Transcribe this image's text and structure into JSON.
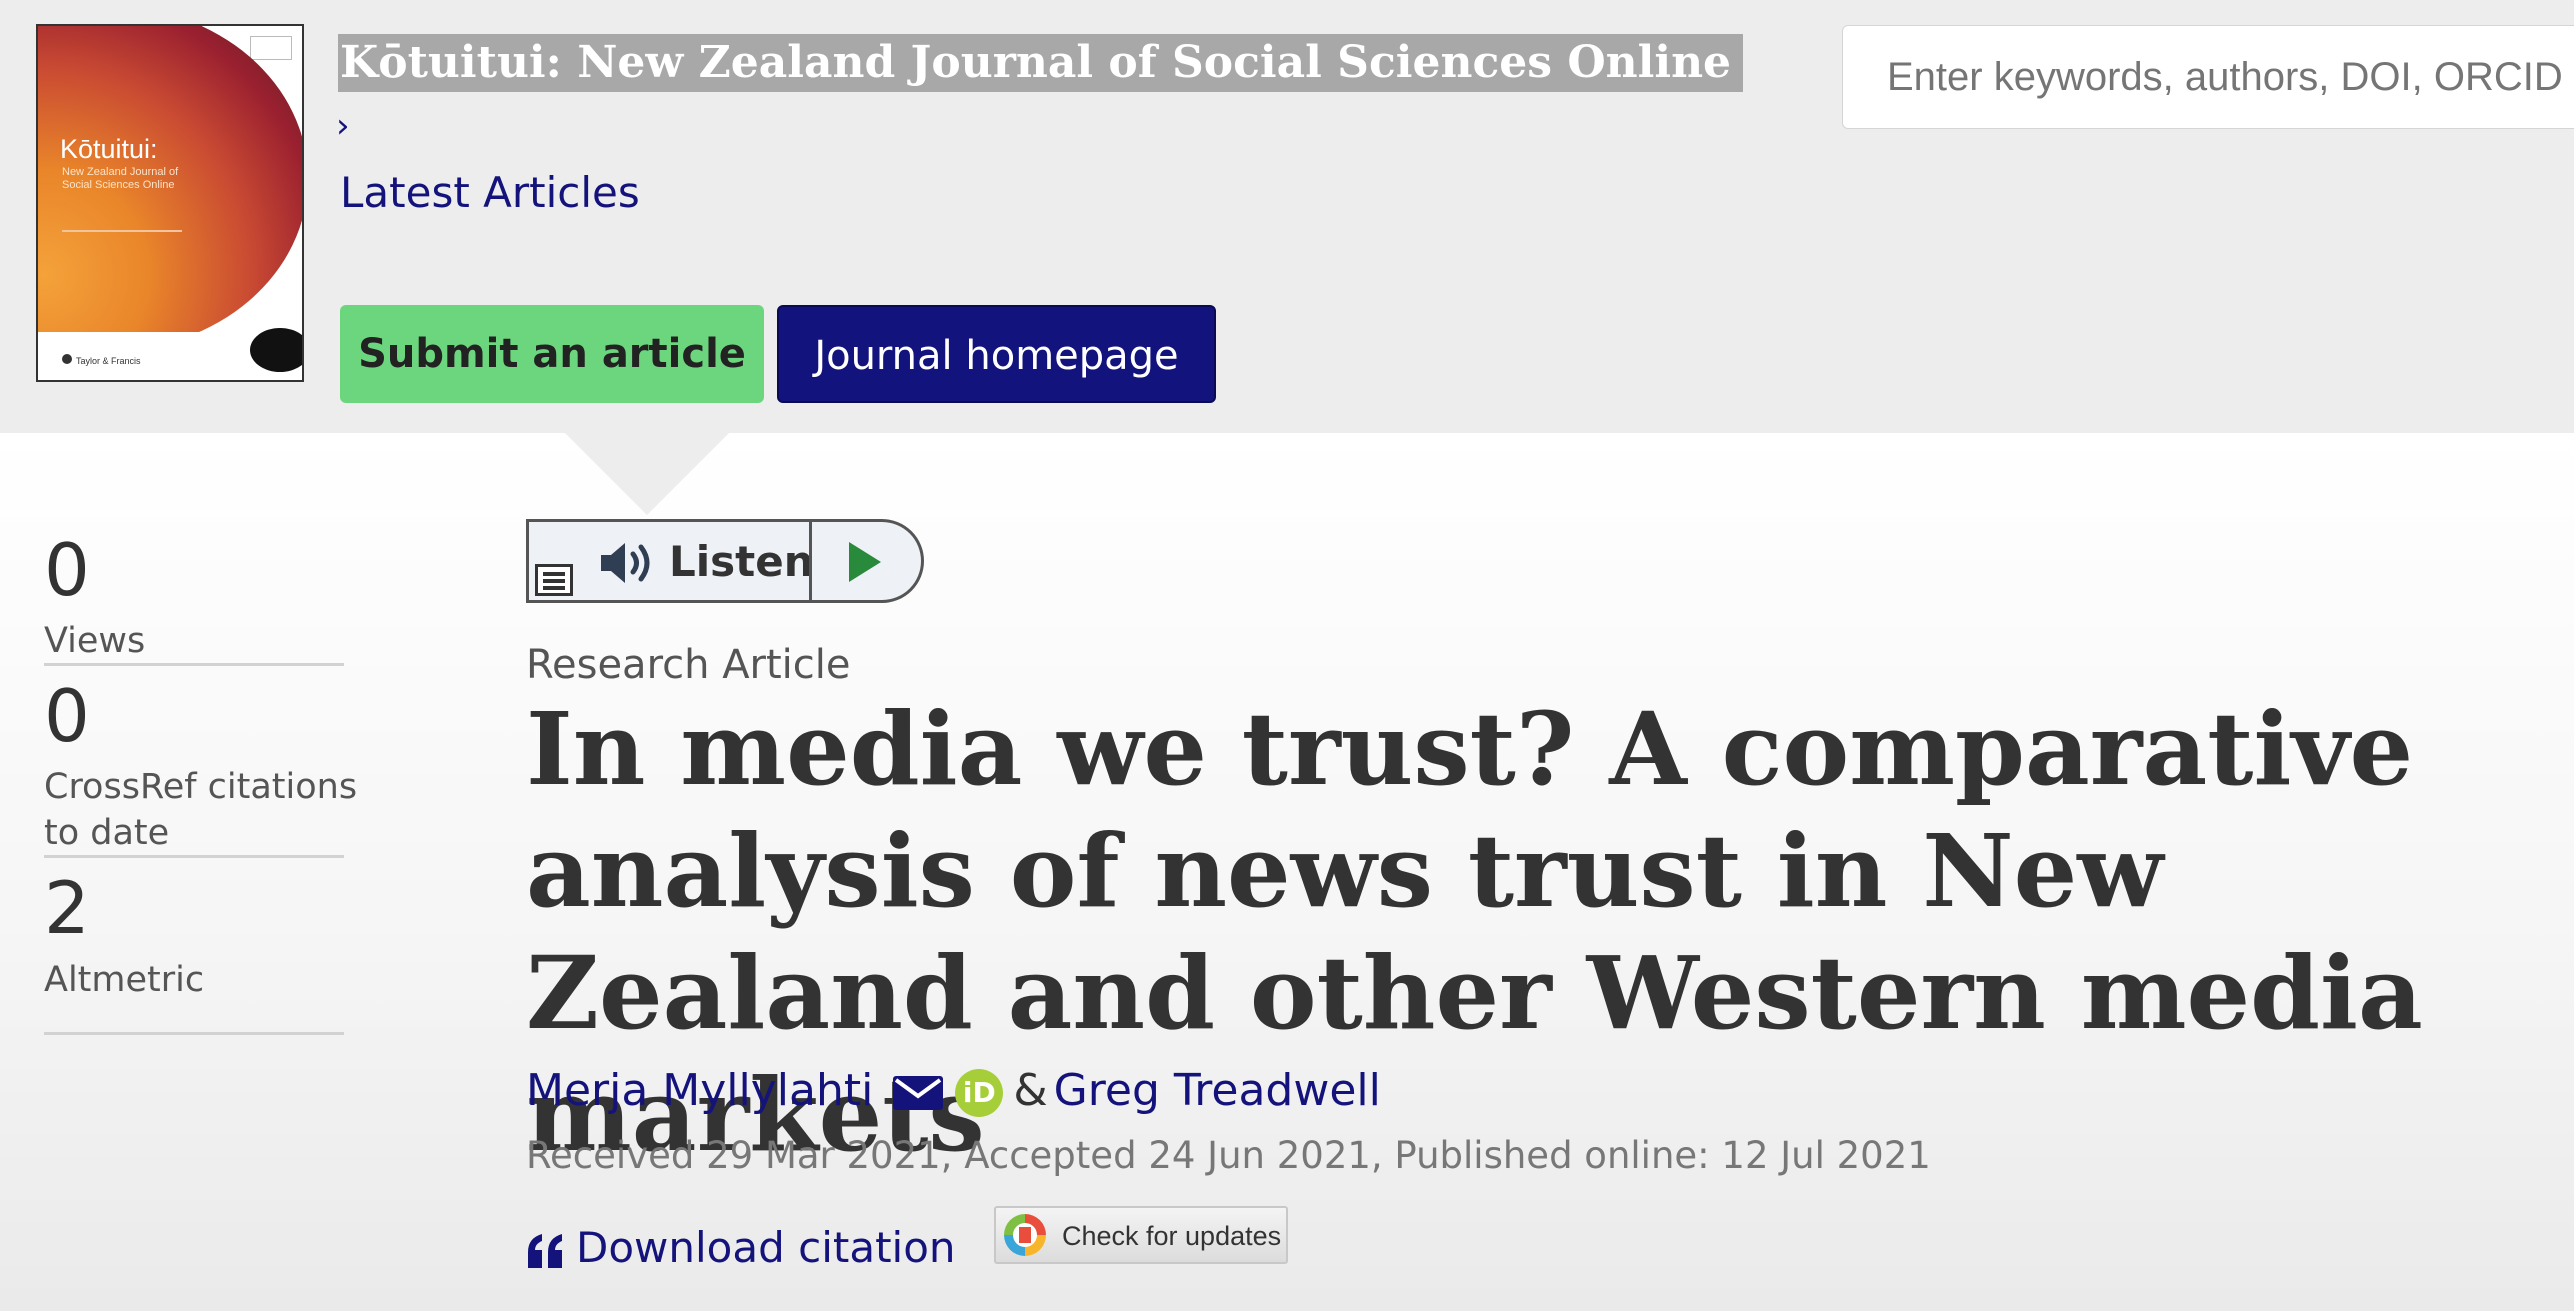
{
  "header": {
    "cover": {
      "title": "Kōtuitui:",
      "subtitle": "New Zealand Journal of Social Sciences Online",
      "publisher": "Taylor & Francis"
    },
    "journal_title": "Kōtuitui: New Zealand Journal of Social Sciences Online",
    "breadcrumb_separator": "›",
    "latest_articles": "Latest Articles",
    "submit_label": "Submit an article",
    "homepage_label": "Journal homepage",
    "search_placeholder": "Enter keywords, authors, DOI, ORCID or phrase"
  },
  "metrics": [
    {
      "value": "0",
      "label": "Views"
    },
    {
      "value": "0",
      "label": "CrossRef citations to date"
    },
    {
      "value": "2",
      "label": "Altmetric"
    }
  ],
  "listen": {
    "label": "Listen"
  },
  "article": {
    "type": "Research Article",
    "title": "In media we trust? A comparative analysis of news trust in New Zealand and other Western media markets",
    "authors": [
      "Merja Myllylahti",
      "Greg Treadwell"
    ],
    "author_separator": "&",
    "orcid_text": "iD",
    "history": "Received 29 Mar 2021, Accepted 24 Jun 2021, Published online: 12 Jul 2021",
    "download_citation": "Download citation",
    "check_updates": "Check for updates"
  },
  "colors": {
    "link": "#14137c",
    "submit_bg": "#6cd67e",
    "homepage_bg": "#12137c",
    "orcid": "#a6ce39",
    "title_highlight": "#a8a8a8"
  },
  "icons": [
    "menu-icon",
    "speaker-icon",
    "play-icon",
    "mail-icon",
    "orcid-icon",
    "quote-icon",
    "crossmark-icon"
  ]
}
